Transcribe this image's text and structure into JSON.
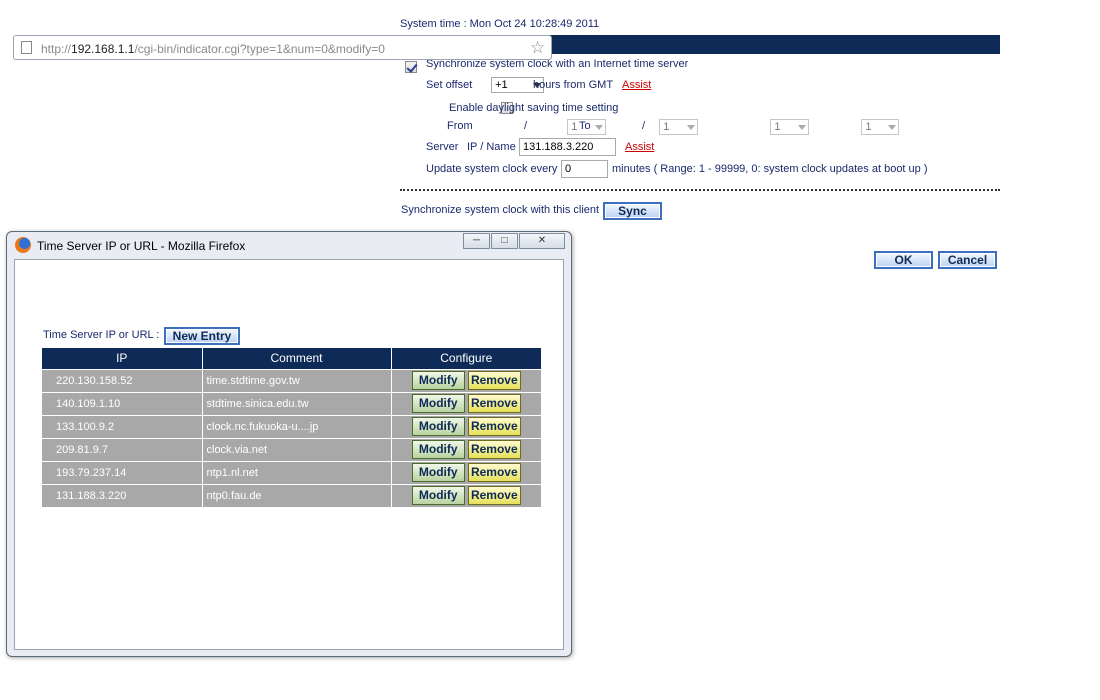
{
  "system_time": "System time : Mon Oct 24 10:28:49 2011",
  "section_title": "Synchronize system clock",
  "sync_internet": {
    "label": "Synchronize system clock with an Internet time server",
    "checked": true
  },
  "offset": {
    "label": "Set offset",
    "value": "+1",
    "suffix": "hours from GMT",
    "assist": "Assist"
  },
  "daylight": {
    "label": "Enable daylight saving time setting",
    "checked": false,
    "from_label": "From",
    "to_label": "To",
    "from_month": "1",
    "from_day": "1",
    "to_month": "1",
    "to_day": "1",
    "sep": "/"
  },
  "server": {
    "label": "Server",
    "ip_label": "IP / Name",
    "value": "131.188.3.220",
    "assist": "Assist"
  },
  "update": {
    "label": "Update system clock every",
    "value": "0",
    "suffix": "minutes ( Range: 1 - 99999, 0: system clock updates at boot up )"
  },
  "sync_client": {
    "label": "Synchronize system clock with this client",
    "button": "Sync"
  },
  "actions": {
    "ok": "OK",
    "cancel": "Cancel"
  },
  "popup": {
    "title": "Time Server IP or URL - Mozilla Firefox",
    "url_prefix": "http://",
    "url_host": "192.168.1.1",
    "url_path": "/cgi-bin/indicator.cgi?type=1&num=0&modify=0",
    "label": "Time Server IP or URL :",
    "new_entry": "New  Entry",
    "columns": [
      "IP",
      "Comment",
      "Configure"
    ],
    "modify_label": "Modify",
    "remove_label": "Remove",
    "rows": [
      {
        "ip": "220.130.158.52",
        "comment": "time.stdtime.gov.tw"
      },
      {
        "ip": "140.109.1.10",
        "comment": "stdtime.sinica.edu.tw"
      },
      {
        "ip": "133.100.9.2",
        "comment": "clock.nc.fukuoka-u....jp"
      },
      {
        "ip": "209.81.9.7",
        "comment": "clock.via.net"
      },
      {
        "ip": "193.79.237.14",
        "comment": "ntp1.nl.net"
      },
      {
        "ip": "131.188.3.220",
        "comment": "ntp0.fau.de"
      }
    ]
  }
}
